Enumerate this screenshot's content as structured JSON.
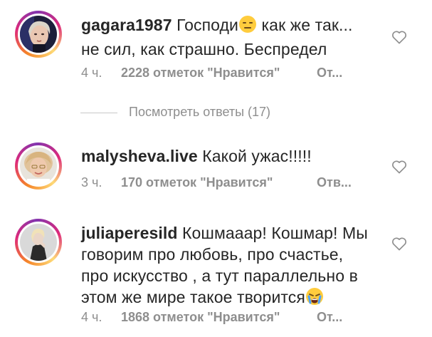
{
  "comments": [
    {
      "username": "gagara1987",
      "text_part1": "Господи",
      "emoji": "expressionless-face-emoji",
      "text_part2": " как же так...",
      "text_line2": "не сил, как страшно. Беспредел",
      "time": "4 ч.",
      "likes": "2228 отметок \"Нравится\"",
      "reply": "От..."
    },
    {
      "username": "malysheva.live",
      "text": "Какой ужас!!!!!",
      "time": "3 ч.",
      "likes": "170 отметок \"Нравится\"",
      "reply": "Отв..."
    },
    {
      "username": "juliaperesild",
      "text_line1": "Кошмааар! Кошмар! Мы",
      "text_line2": "говорим про любовь, про счастье,",
      "text_line3": "про искусство , а тут параллельно в",
      "text_line4": "этом же мире такое творится",
      "emoji": "crying-face-emoji",
      "time": "4 ч.",
      "likes": "1868 отметок \"Нравится\"",
      "reply": "От..."
    }
  ],
  "view_replies": "Посмотреть ответы (17)",
  "icons": {
    "like": "heart-outline-icon"
  },
  "colors": {
    "text": "#262626",
    "secondary": "#8e8e8e",
    "divider": "#c7c7c7",
    "story_ring": [
      "#f58529",
      "#dd2a7b",
      "#8134af"
    ]
  }
}
